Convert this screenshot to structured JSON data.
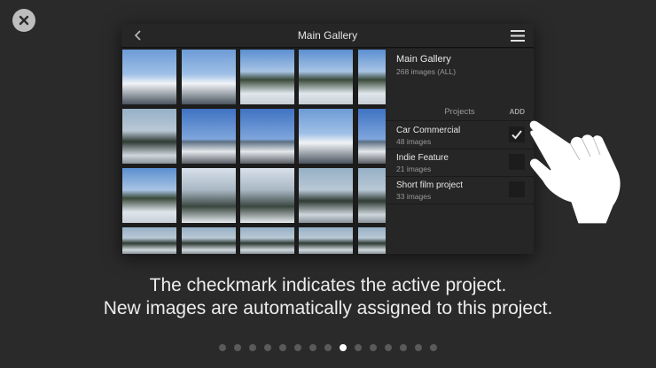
{
  "device": {
    "title": "Main Gallery"
  },
  "gallery": {
    "name": "Main Gallery",
    "count": "268 images (ALL)"
  },
  "projects": {
    "header": "Projects",
    "add_label": "ADD",
    "items": [
      {
        "name": "Car Commercial",
        "count": "48 images",
        "active": true
      },
      {
        "name": "Indie Feature",
        "count": "21 images",
        "active": false
      },
      {
        "name": "Short film project",
        "count": "33 images",
        "active": false
      }
    ]
  },
  "caption": {
    "line1": "The checkmark indicates the active project.",
    "line2": "New images are automatically assigned to this project."
  },
  "pagination": {
    "total": 15,
    "current": 9
  },
  "colors": {
    "background": "#2a2a2a",
    "active_dot": "#ffffff",
    "inactive_dot": "#5a5a5a"
  },
  "icons": {
    "close": "close-icon",
    "back": "chevron-left-icon",
    "menu": "hamburger-menu-icon",
    "check": "checkmark-icon",
    "hand": "pointing-hand-icon"
  }
}
